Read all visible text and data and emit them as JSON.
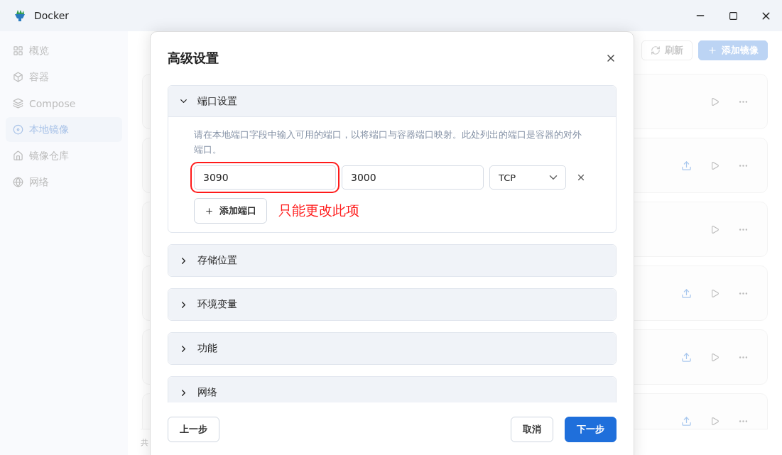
{
  "window": {
    "title": "Docker"
  },
  "sidebar": {
    "items": [
      {
        "label": "概览",
        "selected": false
      },
      {
        "label": "容器",
        "selected": false
      },
      {
        "label": "Compose",
        "selected": false
      },
      {
        "label": "本地镜像",
        "selected": true
      },
      {
        "label": "镜像仓库",
        "selected": false
      },
      {
        "label": "网络",
        "selected": false
      }
    ]
  },
  "page": {
    "refresh": "刷新",
    "add": "添加镜像",
    "footer": "共",
    "cards": [
      {
        "upload": false
      },
      {
        "upload": true
      },
      {
        "upload": false
      },
      {
        "upload": true
      },
      {
        "upload": true
      },
      {
        "upload": true
      }
    ]
  },
  "dialog": {
    "title": "高级设置",
    "sections": [
      {
        "title": "端口设置",
        "expanded": true
      },
      {
        "title": "存储位置",
        "expanded": false
      },
      {
        "title": "环境变量",
        "expanded": false
      },
      {
        "title": "功能",
        "expanded": false
      },
      {
        "title": "网络",
        "expanded": false
      }
    ],
    "port_help": "请在本地端口字段中输入可用的端口，以将端口与容器端口映射。此处列出的端口是容器的对外端口。",
    "ports": [
      {
        "host": "3090",
        "container": "3000",
        "protocol": "TCP",
        "highlighted": true
      }
    ],
    "add_port": "添加端口",
    "annotation": "只能更改此项",
    "buttons": {
      "back": "上一步",
      "cancel": "取消",
      "next": "下一步"
    }
  }
}
